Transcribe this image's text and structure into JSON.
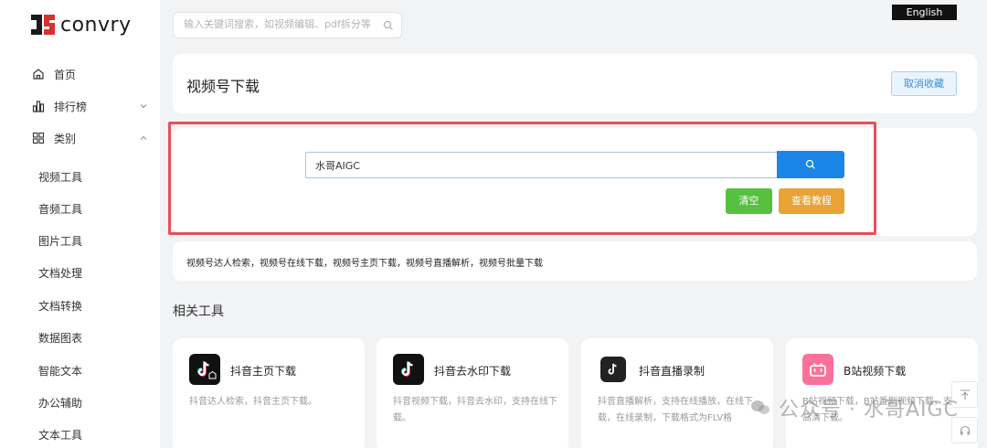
{
  "brand": {
    "name": "convry"
  },
  "top_search": {
    "placeholder": "输入关键词搜索，如视频编辑、pdf拆分等"
  },
  "language_button": "English",
  "sidebar": {
    "home": "首页",
    "ranking": "排行榜",
    "categories": "类别",
    "sub_items": [
      "视频工具",
      "音频工具",
      "图片工具",
      "文档处理",
      "文档转换",
      "数据图表",
      "智能文本",
      "办公辅助",
      "文本工具"
    ]
  },
  "page": {
    "title": "视频号下载",
    "unfavorite_label": "取消收藏",
    "input_value": "水哥AIGC",
    "clear_label": "清空",
    "tutorial_label": "查看教程",
    "tags": "视频号达人检索，视频号在线下载，视频号主页下载，视频号直播解析，视频号批量下载"
  },
  "related": {
    "title": "相关工具",
    "tools": [
      {
        "name": "抖音主页下载",
        "desc": "抖音达人检索，抖音主页下载。",
        "icon": "tiktok-home-icon"
      },
      {
        "name": "抖音去水印下载",
        "desc": "抖音视频下载，抖音去水印，支持在线下载。",
        "icon": "tiktok-icon"
      },
      {
        "name": "抖音直播录制",
        "desc": "抖音直播解析，支持在线播放，在线下载，在线录制，下载格式为FLV格",
        "icon": "tiktok-icon"
      },
      {
        "name": "B站视频下载",
        "desc": "B站视频下载，B站番剧视频下载，支持高清下载。",
        "icon": "bilibili-icon"
      }
    ]
  },
  "watermark": "公众号 · 水哥AIGC",
  "colors": {
    "accent": "#1c86e8",
    "clear": "#58c03f",
    "tutorial": "#e8a235",
    "highlight": "#e94f57"
  }
}
